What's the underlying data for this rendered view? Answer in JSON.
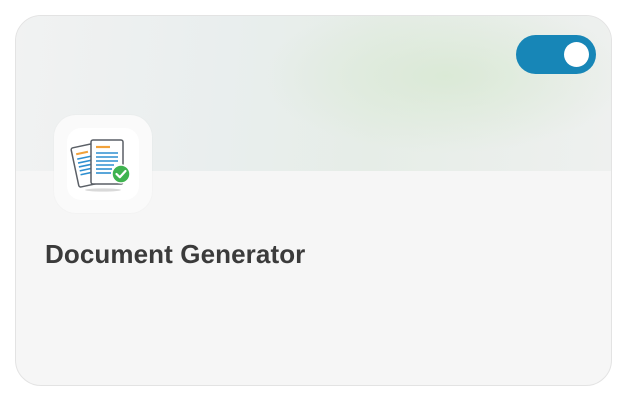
{
  "card": {
    "title": "Document Generator",
    "icon": "document-generator-icon",
    "toggle": {
      "state": "on",
      "color": "#1786b7"
    }
  },
  "colors": {
    "title_text": "#3b3b3b",
    "card_background": "#f6f6f6",
    "success_badge": "#3fb34f"
  }
}
